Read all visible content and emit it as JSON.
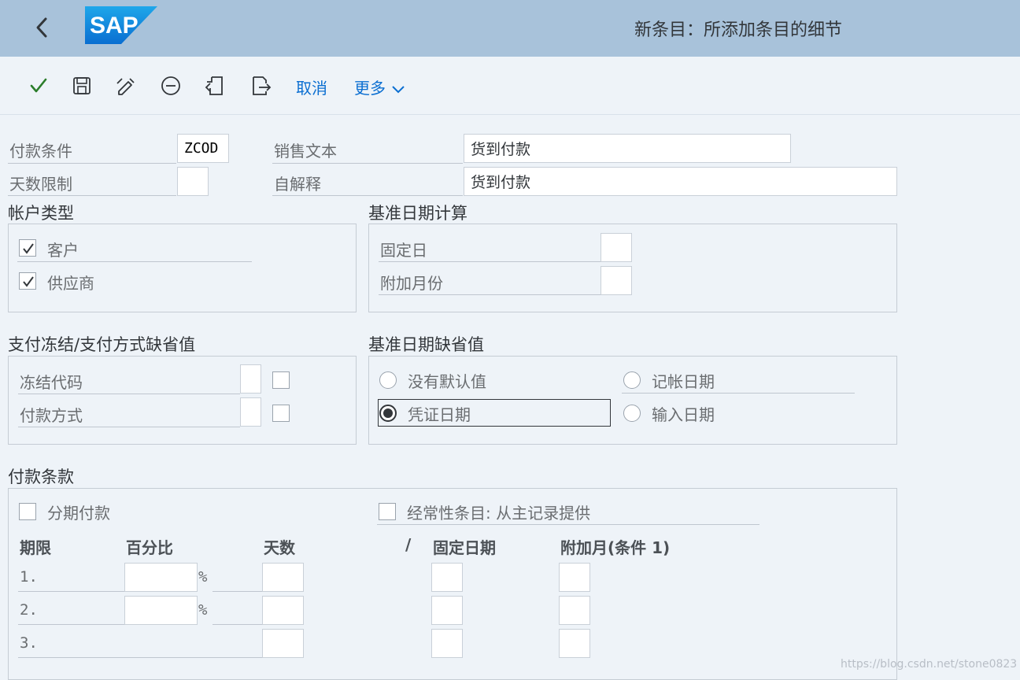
{
  "header": {
    "logo_text": "SAP",
    "title": "新条目：所添加条目的细节",
    "brand_color": "#0a6ed1",
    "bar_color": "#a8c2da"
  },
  "toolbar": {
    "icons": [
      "check-icon",
      "save-icon",
      "edit-icon",
      "minus-circle-icon",
      "previous-entry-icon",
      "next-entry-icon"
    ],
    "cancel_label": "取消",
    "more_label": "更多"
  },
  "top_fields": {
    "payment_terms_label": "付款条件",
    "payment_terms_value": "ZCOD",
    "sales_text_label": "销售文本",
    "sales_text_value": "货到付款",
    "day_limit_label": "天数限制",
    "day_limit_value": "",
    "own_explanation_label": "自解释",
    "own_explanation_value": "货到付款"
  },
  "account_type": {
    "title": "帐户类型",
    "customer_label": "客户",
    "customer_checked": true,
    "vendor_label": "供应商",
    "vendor_checked": true
  },
  "baseline_calc": {
    "title": "基准日期计算",
    "fixed_day_label": "固定日",
    "fixed_day_value": "",
    "additional_months_label": "附加月份",
    "additional_months_value": ""
  },
  "payment_block": {
    "title": "支付冻结/支付方式缺省值",
    "block_key_label": "冻结代码",
    "payment_method_label": "付款方式"
  },
  "baseline_default": {
    "title": "基准日期缺省值",
    "options": [
      {
        "label": "没有默认值",
        "selected": false
      },
      {
        "label": "记帐日期",
        "selected": false
      },
      {
        "label": "凭证日期",
        "selected": true
      },
      {
        "label": "输入日期",
        "selected": false
      }
    ]
  },
  "payment_terms": {
    "title": "付款条款",
    "installment_label": "分期付款",
    "recurring_label": "经常性条目: 从主记录提供",
    "columns": {
      "term": "期限",
      "percent": "百分比",
      "days": "天数",
      "slash": "/",
      "fixed_date": "固定日期",
      "additional_month": "附加月(条件 1)"
    },
    "rows": [
      {
        "num": "1.",
        "pct_sign": "%"
      },
      {
        "num": "2.",
        "pct_sign": "%"
      },
      {
        "num": "3.",
        "pct_sign": ""
      }
    ]
  },
  "watermark": "https://blog.csdn.net/stone0823"
}
